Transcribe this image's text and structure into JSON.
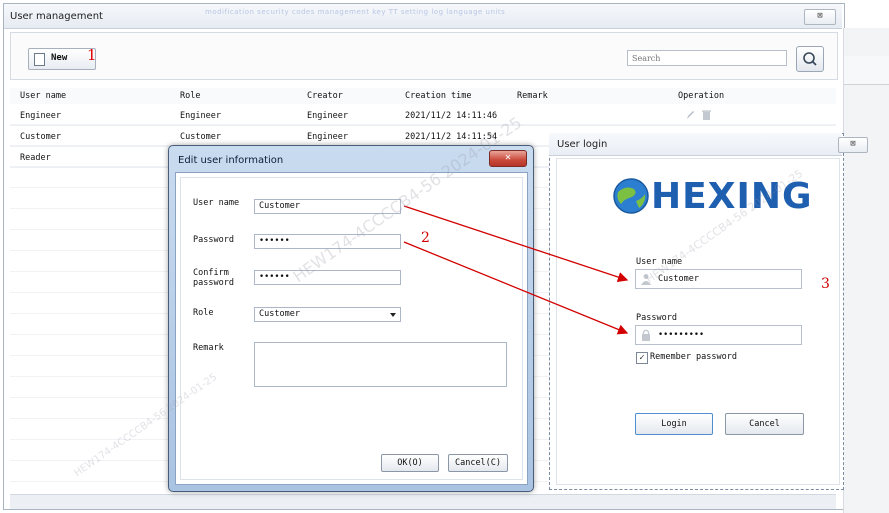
{
  "main_window": {
    "title": "User management",
    "close_glyph": "⊠",
    "faint_menu_text": "modification   security codes   management   key   TT   setting   log   language units"
  },
  "toolbar": {
    "new_label": "New",
    "new_icon": "document-new-icon",
    "search_placeholder": "Search",
    "search_icon": "search-icon"
  },
  "table": {
    "columns": [
      "User name",
      "Role",
      "Creator",
      "Creation time",
      "Remark",
      "Operation"
    ],
    "rows": [
      {
        "user": "Engineer",
        "role": "Engineer",
        "creator": "Engineer",
        "created": "2021/11/2 14:11:46",
        "remark": ""
      },
      {
        "user": "Customer",
        "role": "Customer",
        "creator": "Engineer",
        "created": "2021/11/2 14:11:54",
        "remark": ""
      },
      {
        "user": "Reader",
        "role": "",
        "creator": "",
        "created": "",
        "remark": ""
      }
    ],
    "operation_icons": [
      "edit-icon",
      "delete-icon"
    ]
  },
  "edit_dialog": {
    "title": "Edit user information",
    "close_glyph": "✕",
    "user_name_label": "User name",
    "user_name_value": "Customer",
    "password_label": "Password",
    "password_value": "••••••",
    "confirm_label": "Confirm password",
    "confirm_value": "••••••",
    "role_label": "Role",
    "role_value": "Customer",
    "remark_label": "Remark",
    "remark_value": "",
    "ok_label": "OK(O)",
    "cancel_label": "Cancel(C)"
  },
  "login_dialog": {
    "title": "User login",
    "close_glyph": "⊠",
    "logo_text": "HEXING",
    "logo_color": "#1f5fb0",
    "user_name_label": "User name",
    "user_name_value": "Customer",
    "password_label": "Password",
    "password_value": "•••••••••",
    "remember_label": "Remember password",
    "remember_checked": true,
    "login_label": "Login",
    "cancel_label": "Cancel"
  },
  "annotations": {
    "step1": "1",
    "step2": "2",
    "step3": "3",
    "arrow_color": "#d20000"
  },
  "watermark": "HEW174-4CCCCB4-56 2024-01-25"
}
